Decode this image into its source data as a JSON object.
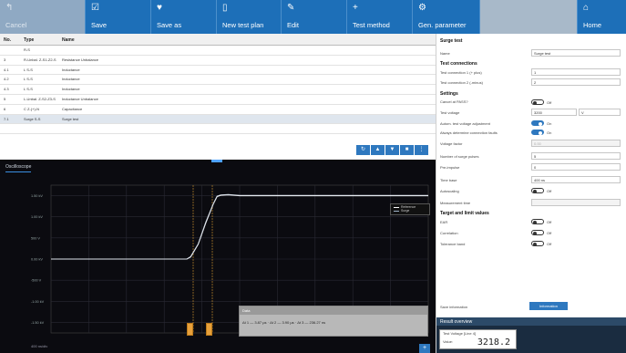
{
  "toolbar": {
    "items": [
      {
        "label": "Cancel",
        "icon": "cancel-icon",
        "glyph": "↰"
      },
      {
        "label": "Save",
        "icon": "save-icon",
        "glyph": "☑"
      },
      {
        "label": "Save as",
        "icon": "save-as-icon",
        "glyph": "♥"
      },
      {
        "label": "New test plan",
        "icon": "new-document-icon",
        "glyph": "▯"
      },
      {
        "label": "Edit",
        "icon": "edit-icon",
        "glyph": "✎"
      },
      {
        "label": "Test method",
        "icon": "test-method-icon",
        "glyph": "+"
      },
      {
        "label": "Gen. parameter",
        "icon": "gear-icon",
        "glyph": "⚙"
      },
      {
        "label": "",
        "icon": "",
        "glyph": ""
      },
      {
        "label": "Home",
        "icon": "home-icon",
        "glyph": "⌂"
      }
    ]
  },
  "table": {
    "columns": [
      "No.",
      "Type",
      "Name"
    ],
    "rows": [
      {
        "no": "",
        "type": "R-S",
        "name": ""
      },
      {
        "no": "3",
        "type": "R-Unbal. Z-S1-Z2-S",
        "name": "Resistance Unbalance"
      },
      {
        "no": "4.1",
        "type": "L S-S",
        "name": "Inductance"
      },
      {
        "no": "4.2",
        "type": "L S-S",
        "name": "Inductance"
      },
      {
        "no": "4.3",
        "type": "L S-S",
        "name": "Inductance"
      },
      {
        "no": "5",
        "type": "L-Unbal. Z-S2-Z3-S",
        "name": "Inductance Unbalance"
      },
      {
        "no": "6",
        "type": "C Z-(+)-N",
        "name": "Capacitance"
      },
      {
        "no": "7.1",
        "type": "Surge S-S",
        "name": "Surge test"
      },
      {
        "no": "",
        "type": "",
        "name": ""
      }
    ]
  },
  "oscilloscope": {
    "tab_label": "Oscilloscope",
    "y_tick_labels": [
      "1.50 kV",
      "1.00 kV",
      "500 V",
      "0.00 kV",
      "-500 V",
      "-1.00 kV",
      "-1.50 kV"
    ],
    "legend": [
      "Reference",
      "Surge"
    ],
    "info_box": {
      "title": "Data",
      "values": "Δt 1 — 3.87 µs · Δt 2 — 3.90 µs · Δt 3 — 236.27 ns"
    },
    "footer": "400 ns/div"
  },
  "chart_data": {
    "type": "line",
    "title": "",
    "xlabel": "",
    "ylabel": "",
    "ylim": [
      -1.75,
      1.75
    ],
    "xlim": [
      0,
      10
    ],
    "grid": true,
    "series": [
      {
        "name": "Reference",
        "color": "#ffffff",
        "x": [
          0,
          3.6,
          3.7,
          3.9,
          4.1,
          4.3,
          4.4,
          4.5,
          4.7,
          5.0,
          10
        ],
        "y": [
          0.0,
          0.0,
          0.05,
          0.35,
          0.85,
          1.3,
          1.48,
          1.51,
          1.52,
          1.5,
          1.5
        ]
      },
      {
        "name": "Surge",
        "color": "#cfd8e3",
        "x": [
          0,
          3.6,
          3.7,
          3.9,
          4.1,
          4.3,
          4.4,
          4.5,
          4.7,
          5.0,
          10
        ],
        "y": [
          0.0,
          0.0,
          0.06,
          0.36,
          0.87,
          1.31,
          1.49,
          1.52,
          1.53,
          1.51,
          1.51
        ]
      }
    ]
  },
  "panel": {
    "title": "Surge test",
    "name_label": "Name",
    "name_value": "Surge test",
    "connections_head": "Test connections",
    "conn1_label": "Test connection 1 (+ plus)",
    "conn1_value": "1",
    "conn2_label": "Test connection 2 (-minus)",
    "conn2_value": "2",
    "settings_head": "Settings",
    "cancel_label": "Cancel at PASS?",
    "cancel_state": "Off",
    "voltage_label": "Test voltage",
    "voltage_value": "3200",
    "voltage_unit": "V",
    "autoadj_label": "Autom. test voltage adjustment",
    "autoadj_state": "On",
    "conn_fault_label": "Always determine connection faults",
    "conn_fault_state": "On",
    "voltage_factor_label": "Voltage factor",
    "voltage_factor_value": "0.00",
    "pulses_label": "Number of surge pulses",
    "pulses_value": "5",
    "pre_label": "Pre-impulse",
    "pre_value": "0",
    "timebase_label": "Time base",
    "timebase_value": "400 ns",
    "autoscaling_label": "Autoscaling",
    "autoscaling_state": "Off",
    "measurement_time_label": "Measurement time",
    "target_head": "Target and limit values",
    "eab_label": "EAR",
    "eab_state": "Off",
    "correlation_label": "Correlation",
    "correlation_state": "Off",
    "dmax_label": "Tolerance band",
    "dmax_state": "Off",
    "save_info_label": "Save information",
    "save_info_button": "Information",
    "result_head": "Result overview",
    "result_box_label": "Test Voltage [Line 4]",
    "result_box_sub": "Value:",
    "result_value": "3218.2"
  }
}
